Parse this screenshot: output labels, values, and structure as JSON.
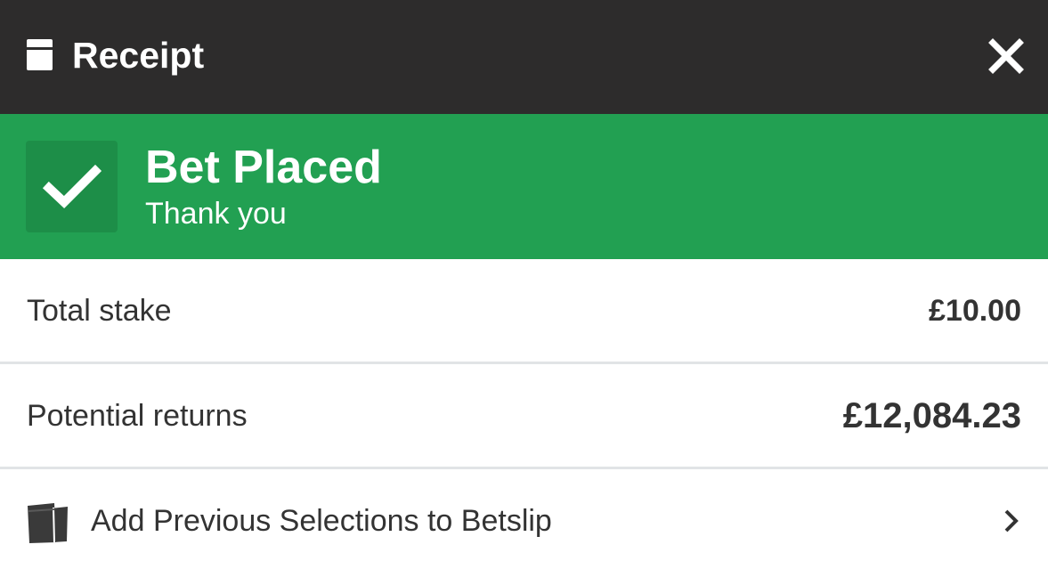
{
  "header": {
    "title": "Receipt",
    "icon": "receipt-icon",
    "close_icon": "close-icon"
  },
  "banner": {
    "title": "Bet Placed",
    "subtitle": "Thank you",
    "icon": "checkmark-icon",
    "color": "#22a052"
  },
  "summary": {
    "total_stake_label": "Total stake",
    "total_stake_value": "£10.00",
    "potential_returns_label": "Potential returns",
    "potential_returns_value": "£12,084.23"
  },
  "actions": {
    "add_previous_label": "Add Previous Selections to Betslip",
    "add_previous_icon": "betslip-icon",
    "chevron_icon": "chevron-right-icon"
  },
  "colors": {
    "header_bg": "#2d2c2c",
    "success_green": "#22a052",
    "text": "#333333"
  }
}
